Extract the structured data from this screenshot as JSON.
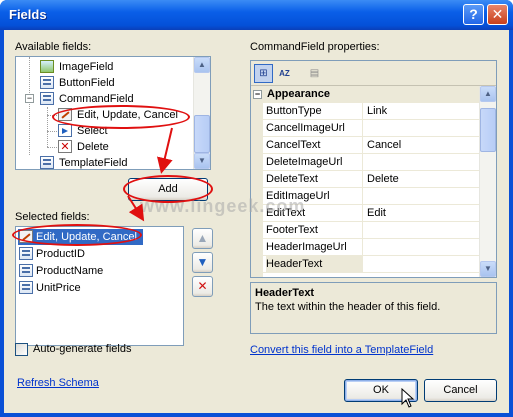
{
  "window": {
    "title": "Fields",
    "help_glyph": "?",
    "close_glyph": "✕"
  },
  "available": {
    "label": "Available fields:",
    "items": [
      {
        "label": "ImageField",
        "icon": "image-field-icon"
      },
      {
        "label": "ButtonField",
        "icon": "field-icon"
      },
      {
        "label": "CommandField",
        "icon": "field-icon",
        "expanded": true
      },
      {
        "label": "Edit, Update, Cancel",
        "icon": "edit-icon"
      },
      {
        "label": "Select",
        "icon": "select-icon"
      },
      {
        "label": "Delete",
        "icon": "delete-icon"
      },
      {
        "label": "TemplateField",
        "icon": "field-icon"
      }
    ],
    "expander_glyph": "−"
  },
  "add_button": "Add",
  "selected": {
    "label": "Selected fields:",
    "items": [
      {
        "label": "Edit, Update, Cancel",
        "icon": "edit-icon",
        "selected": true
      },
      {
        "label": "ProductID",
        "icon": "field-icon"
      },
      {
        "label": "ProductName",
        "icon": "field-icon"
      },
      {
        "label": "UnitPrice",
        "icon": "field-icon"
      }
    ]
  },
  "order_buttons": {
    "up": "▲",
    "down": "▼",
    "delete": "✕"
  },
  "properties": {
    "label": "CommandField properties:",
    "toolbar": {
      "categorized": "⊞",
      "alphabetical": "AZ",
      "pages": "▤"
    },
    "category": "Appearance",
    "category_expander": "−",
    "rows": [
      {
        "name": "ButtonType",
        "value": "Link"
      },
      {
        "name": "CancelImageUrl",
        "value": ""
      },
      {
        "name": "CancelText",
        "value": "Cancel"
      },
      {
        "name": "DeleteImageUrl",
        "value": ""
      },
      {
        "name": "DeleteText",
        "value": "Delete"
      },
      {
        "name": "EditImageUrl",
        "value": ""
      },
      {
        "name": "EditText",
        "value": "Edit"
      },
      {
        "name": "FooterText",
        "value": ""
      },
      {
        "name": "HeaderImageUrl",
        "value": ""
      },
      {
        "name": "HeaderText",
        "value": "",
        "selected": true
      }
    ],
    "desc_title": "HeaderText",
    "desc_text": "The text within the header of this field."
  },
  "auto_generate": {
    "label": "Auto-generate fields",
    "checked": false
  },
  "convert_link": "Convert this field into a TemplateField",
  "refresh_link": "Refresh Schema",
  "ok_button": "OK",
  "cancel_button": "Cancel",
  "watermark": "www.lingeek.com",
  "colors": {
    "title_bar": "#0a5fe8",
    "annotation": "#e01010",
    "selection": "#316ac5",
    "link": "#0033cc"
  }
}
